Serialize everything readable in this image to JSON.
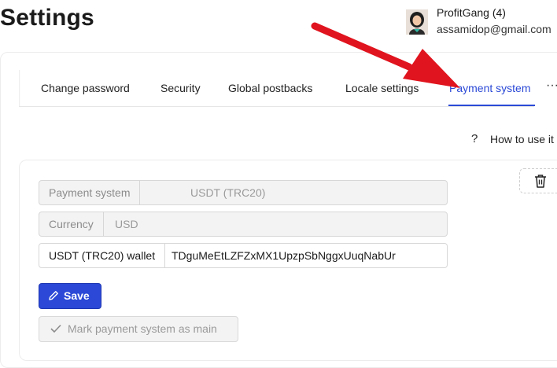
{
  "page": {
    "title": "Settings"
  },
  "user": {
    "name": "ProfitGang (4)",
    "email": "assamidop@gmail.com"
  },
  "tabs": [
    {
      "label": "Change password",
      "active": false
    },
    {
      "label": "Security",
      "active": false
    },
    {
      "label": "Global postbacks",
      "active": false
    },
    {
      "label": "Locale settings",
      "active": false
    },
    {
      "label": "Payment system",
      "active": true
    }
  ],
  "tabs_more": "···",
  "help": {
    "icon": "question-icon",
    "icon_glyph": "?",
    "label": "How to use it"
  },
  "form": {
    "payment_system": {
      "label": "Payment system",
      "value": "USDT (TRC20)"
    },
    "currency": {
      "label": "Currency",
      "value": "USD"
    },
    "wallet": {
      "label": "USDT (TRC20) wallet",
      "value": "TDguMeEtLZFZxMX1UpzpSbNggxUuqNabUr"
    }
  },
  "buttons": {
    "save": "Save",
    "mark_main": "Mark payment system as main"
  },
  "colors": {
    "accent": "#2b49d6",
    "annotation_arrow": "#e0141e"
  }
}
